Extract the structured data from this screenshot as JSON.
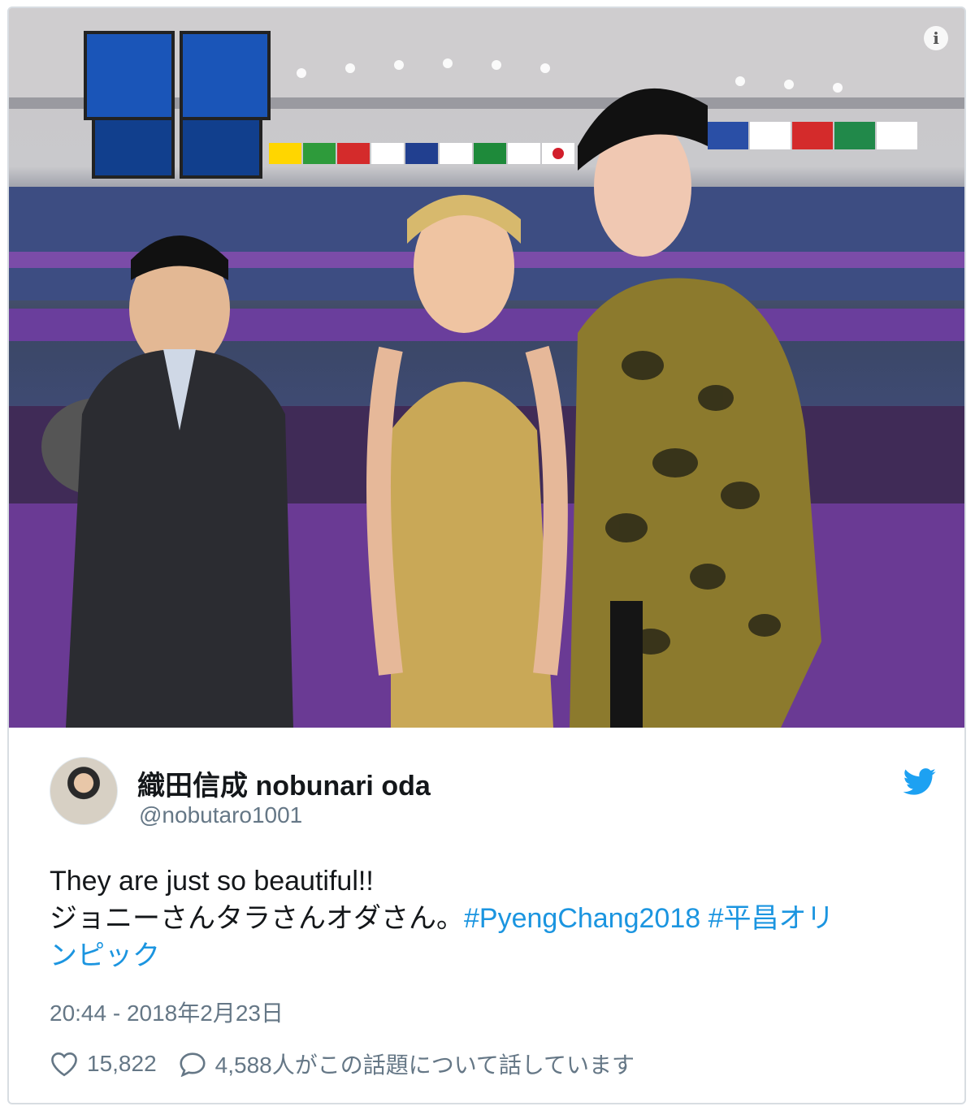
{
  "tweet": {
    "author_name": "織田信成 nobunari oda",
    "author_handle": "@nobutaro1001",
    "text_line1": "They are just so beautiful!!",
    "text_line2_plain": "ジョニーさんタラさんオダさん。",
    "hashtag1": "#PyengChang2018",
    "hashtag2_part1": "#平昌オリ",
    "hashtag2_part2": "ンピック",
    "timestamp": "20:44 - 2018年2月23日",
    "like_count": "15,822",
    "conversation_text": "4,588人がこの話題について話しています"
  },
  "photo": {
    "info_label": "i"
  },
  "icons": {
    "info": "info-icon",
    "bird": "twitter-bird-icon",
    "like": "heart-icon",
    "reply": "speech-bubble-icon"
  },
  "colors": {
    "hashtag": "#1b95e0",
    "twitter_blue": "#1da1f2",
    "secondary_text": "#657786",
    "primary_text": "#14171a"
  }
}
